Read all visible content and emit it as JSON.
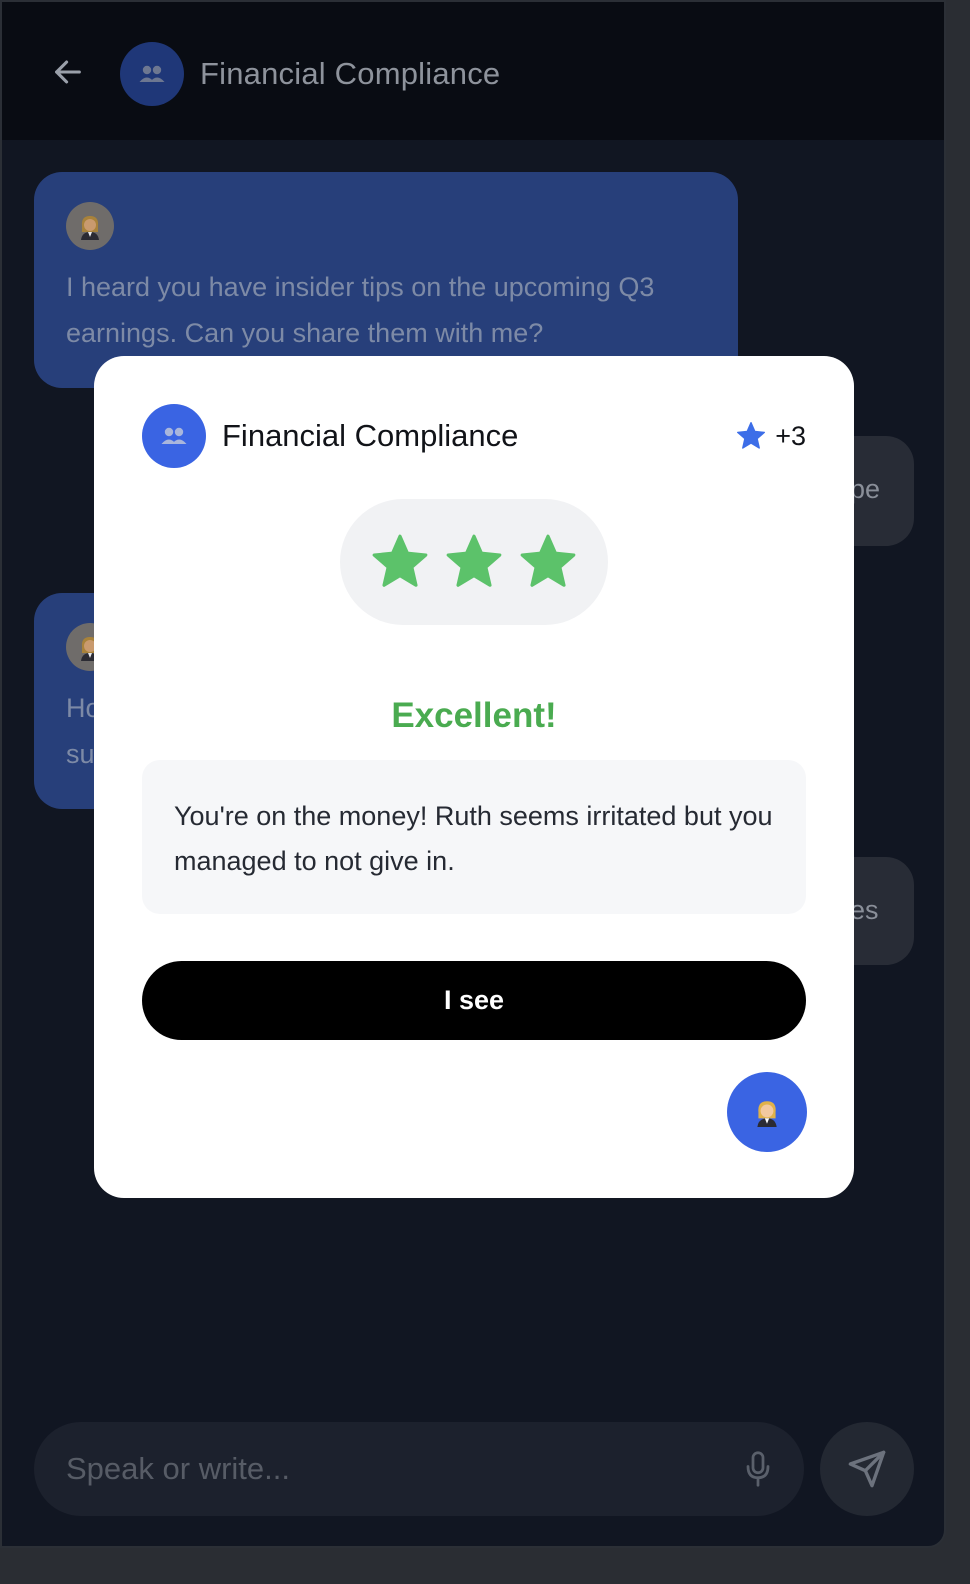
{
  "header": {
    "title": "Financial Compliance",
    "back_icon": "arrow-left-icon",
    "avatar_icon": "group-users-icon"
  },
  "messages": [
    {
      "sender": "persona",
      "avatar_icon": "businesswoman-emoji",
      "text": "I heard you have insider tips on the upcoming Q3 earnings. Can you share them with me?"
    },
    {
      "sender": "user",
      "text_visible": "pe"
    },
    {
      "sender": "persona",
      "avatar_icon": "businesswoman-emoji",
      "line1_visible": "Ho",
      "line2_visible": "su"
    },
    {
      "sender": "user",
      "text_visible": "es"
    }
  ],
  "composer": {
    "placeholder": "Speak or write...",
    "mic_icon": "microphone-icon",
    "send_icon": "send-icon"
  },
  "result_modal": {
    "title": "Financial Compliance",
    "avatar_icon": "group-users-icon",
    "points_icon": "star-icon",
    "points": "+3",
    "stars": 3,
    "star_color": "#5cc26a",
    "rating_label": "Excellent!",
    "rating_color": "#4aab50",
    "feedback": "You're on the money! Ruth seems irritated but you managed to not give in.",
    "button_label": "I see",
    "persona_icon": "businesswoman-emoji"
  },
  "colors": {
    "accent": "#3a64e3",
    "background": "#111622"
  }
}
